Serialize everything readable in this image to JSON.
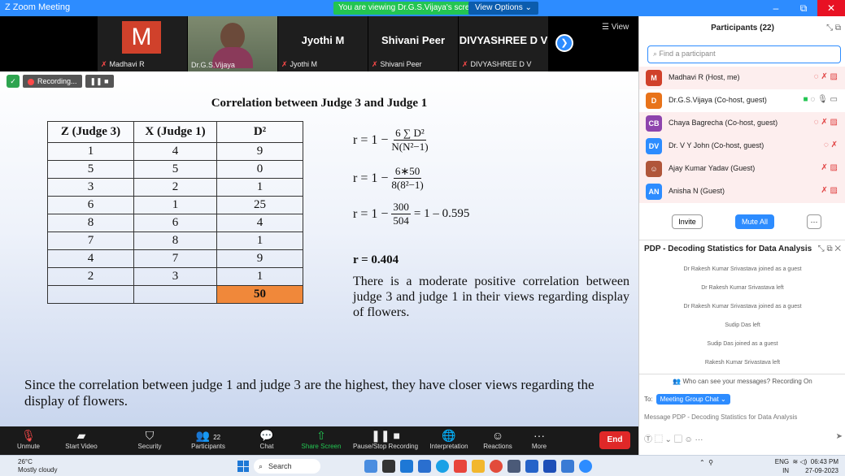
{
  "titlebar": {
    "title": "Zoom Meeting",
    "viewing": "You are viewing Dr.G.S.Vijaya's screen",
    "view_options": "View Options"
  },
  "strip": {
    "tiles": [
      {
        "big": "M",
        "name": "Madhavi R"
      },
      {
        "name": "Dr.G.S.Vijaya"
      },
      {
        "bigname": "Jyothi M",
        "name": "Jyothi M"
      },
      {
        "bigname": "Shivani Peer",
        "name": "Shivani Peer"
      },
      {
        "bigname": "DIVYASHREE D V",
        "name": "DIVYASHREE D V"
      }
    ],
    "view_label": "View"
  },
  "recording": {
    "label": "Recording..."
  },
  "slide": {
    "title": "Correlation between Judge 3 and Judge 1",
    "table": {
      "headers": [
        "Z (Judge 3)",
        "X (Judge 1)",
        "D²"
      ],
      "rows": [
        [
          "1",
          "4",
          "9"
        ],
        [
          "5",
          "5",
          "0"
        ],
        [
          "3",
          "2",
          "1"
        ],
        [
          "6",
          "1",
          "25"
        ],
        [
          "8",
          "6",
          "4"
        ],
        [
          "7",
          "8",
          "1"
        ],
        [
          "4",
          "7",
          "9"
        ],
        [
          "2",
          "3",
          "1"
        ]
      ],
      "total": "50"
    },
    "f1": {
      "lhs": "r = 1 −",
      "num": "6 ∑ D²",
      "den": "N(N²−1)"
    },
    "f2": {
      "lhs": "r = 1 −",
      "num": "6∗50",
      "den": "8(8²−1)"
    },
    "f3": {
      "lhs": "r = 1 −",
      "num": "300",
      "den": "504",
      "rhs": "= 1 – 0.595"
    },
    "result": "r = 0.404",
    "conclusion": "There is a moderate positive correlation between judge 3 and judge 1 in their views regarding display of flowers.",
    "bottom": "Since the correlation between judge 1 and judge 3 are the highest, they have closer views regarding the display of flowers."
  },
  "toolbar": {
    "unmute": "Unmute",
    "start_video": "Start Video",
    "security": "Security",
    "participants": "Participants",
    "participants_count": "22",
    "chat": "Chat",
    "share": "Share Screen",
    "pause": "Pause/Stop Recording",
    "interp": "Interpretation",
    "reactions": "Reactions",
    "more": "More",
    "end": "End"
  },
  "panel": {
    "title": "Participants (22)",
    "search_placeholder": "Find a participant",
    "participants": [
      {
        "initial": "M",
        "name": "Madhavi R (Host, me)",
        "color": "#d0412b"
      },
      {
        "initial": "D",
        "name": "Dr.G.S.Vijaya (Co-host, guest)",
        "color": "#e8731a"
      },
      {
        "initial": "CB",
        "name": "Chaya Bagrecha (Co-host, guest)",
        "color": "#8e44ad"
      },
      {
        "initial": "DV",
        "name": "Dr. V Y John (Co-host, guest)",
        "color": "#2d8cff"
      },
      {
        "initial": "",
        "name": "Ajay Kumar Yadav (Guest)",
        "color": "#b0563a"
      },
      {
        "initial": "AN",
        "name": "Anisha N (Guest)",
        "color": "#2d8cff"
      }
    ],
    "invite": "Invite",
    "mute_all": "Mute All",
    "more": "···"
  },
  "chat": {
    "title": "PDP - Decoding Statistics for Data Analysis",
    "messages": [
      "Dr Rakesh Kumar Srivastava joined as a guest",
      "Dr Rakesh Kumar Srivastava left",
      "Dr Rakesh Kumar Srivastava joined as a guest",
      "Sudip Das left",
      "Sudip Das joined as a guest",
      "Rakesh Kumar Srivastava left"
    ],
    "who_can": "Who can see your messages? Recording On",
    "to_label": "To:",
    "to_value": "Meeting Group Chat",
    "input_placeholder": "Message PDP - Decoding Statistics for Data Analysis"
  },
  "taskbar": {
    "temp": "26°C",
    "weather": "Mostly cloudy",
    "search": "Search",
    "lang1": "ENG",
    "lang2": "IN",
    "time": "06:43 PM",
    "date": "27-09-2023"
  }
}
